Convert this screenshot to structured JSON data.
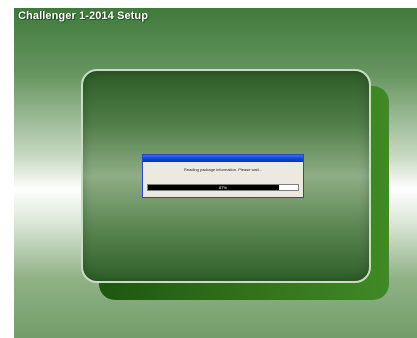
{
  "window": {
    "title": "Challenger 1-2014 Setup"
  },
  "dialog": {
    "message": "Reading package information. Please wait...",
    "progress_percent": 87,
    "progress_label": "87%"
  },
  "colors": {
    "accent": "#0b43d6",
    "panel": "#507d48",
    "shadow": "#2f6e18"
  }
}
